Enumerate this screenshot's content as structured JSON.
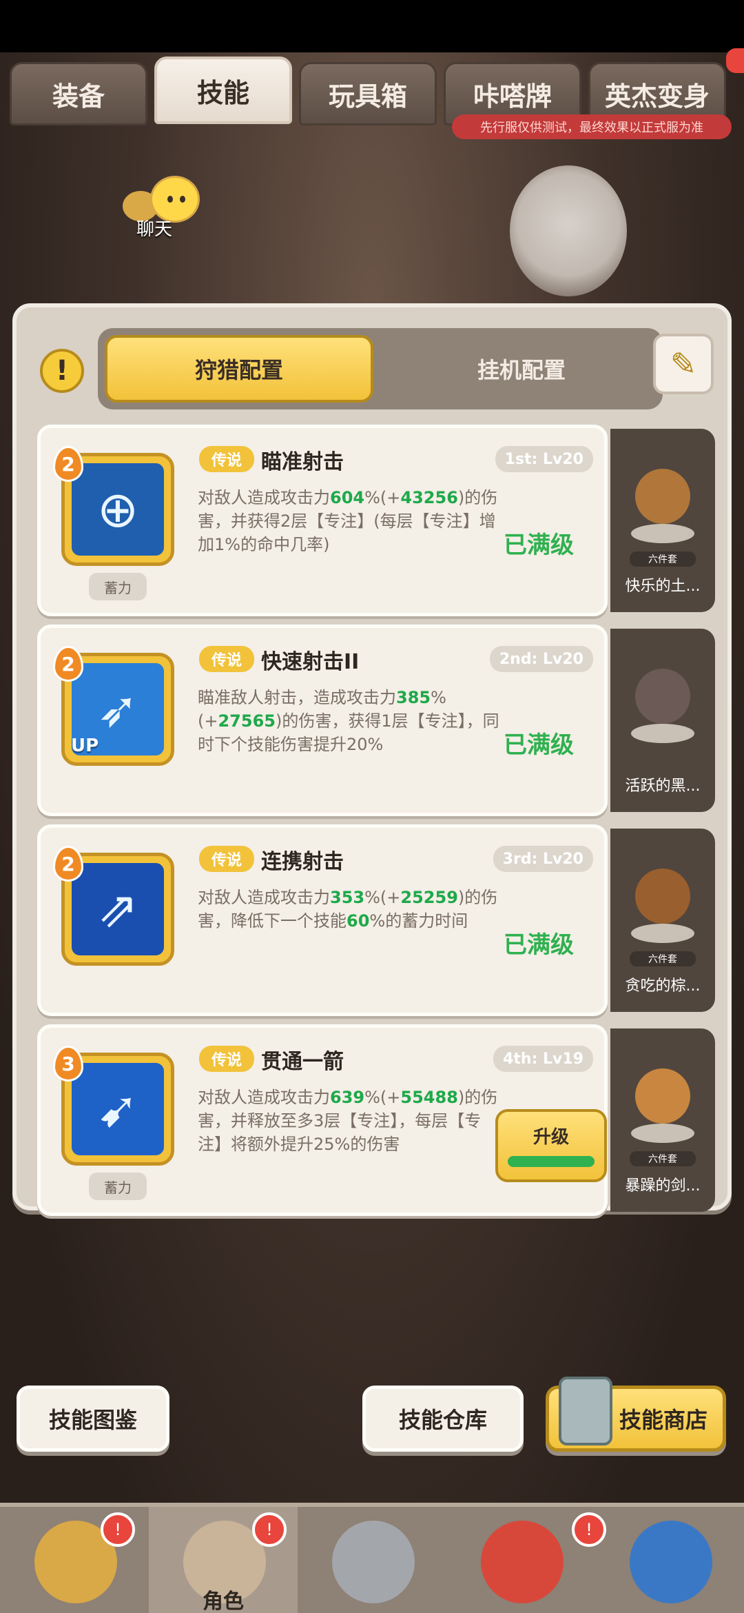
{
  "tabs": [
    {
      "label": "装备"
    },
    {
      "label": "技能"
    },
    {
      "label": "玩具箱"
    },
    {
      "label": "咔嗒牌"
    },
    {
      "label": "英杰变身"
    }
  ],
  "test_notice": "先行服仅供测试，最终效果以正式服为准",
  "chat": {
    "label": "聊天"
  },
  "config": {
    "active": "狩猎配置",
    "inactive": "挂机配置"
  },
  "skills": [
    {
      "badge": "2",
      "rarity": "传说",
      "name": "瞄准射击",
      "lv": "1st: Lv20",
      "desc_pre": "对敌人造成攻击力",
      "desc_hl1": "604",
      "desc_mid1": "%(+",
      "desc_hl2": "43256",
      "desc_post": ")的伤害，并获得2层【专注】(每层【专注】增加1%的命中几率)",
      "status": "已满级",
      "charge": "蓄力",
      "icon_color": "#1f5fae",
      "icon": "crosshair-icon",
      "pet_name": "快乐的土..."
    },
    {
      "badge": "2",
      "rarity": "传说",
      "name": "快速射击II",
      "lv": "2nd: Lv20",
      "desc_pre": "瞄准敌人射击，造成攻击力",
      "desc_hl1": "385",
      "desc_mid1": "%(+",
      "desc_hl2": "27565",
      "desc_post": ")的伤害，获得1层【专注】，同时下个技能伤害提升20%",
      "status": "已满级",
      "up": "UP",
      "icon_color": "#2b7fd6",
      "icon": "bow-arrow-icon",
      "pet_name": "活跃的黑..."
    },
    {
      "badge": "2",
      "rarity": "传说",
      "name": "连携射击",
      "lv": "3rd: Lv20",
      "desc_pre": "对敌人造成攻击力",
      "desc_hl1": "353",
      "desc_mid1": "%(+",
      "desc_hl2": "25259",
      "desc_post": ")的伤害，降低下一个技能",
      "desc_hl3": "60",
      "desc_post2": "%的蓄力时间",
      "status": "已满级",
      "icon_color": "#1a4fb0",
      "icon": "triple-arrow-icon",
      "pet_name": "贪吃的棕..."
    },
    {
      "badge": "3",
      "rarity": "传说",
      "name": "贯通一箭",
      "lv": "4th: Lv19",
      "desc_pre": "对敌人造成攻击力",
      "desc_hl1": "639",
      "desc_mid1": "%(+",
      "desc_hl2": "55488",
      "desc_post": ")的伤害，并释放至多3层【专注】，每层【专注】将额外提升25%的伤害",
      "upgrade": "升级",
      "charge": "蓄力",
      "icon_color": "#1e62c8",
      "icon": "piercing-arrow-icon",
      "pet_name": "暴躁的剑..."
    }
  ],
  "pet_tag": "六件套",
  "buttons": {
    "codex": "技能图鉴",
    "warehouse": "技能仓库",
    "shop": "技能商店"
  },
  "nav": {
    "role_label": "角色"
  },
  "colors": {
    "gold": "#f2c23a",
    "green": "#2fb14f",
    "panel": "#d9d1c6"
  }
}
